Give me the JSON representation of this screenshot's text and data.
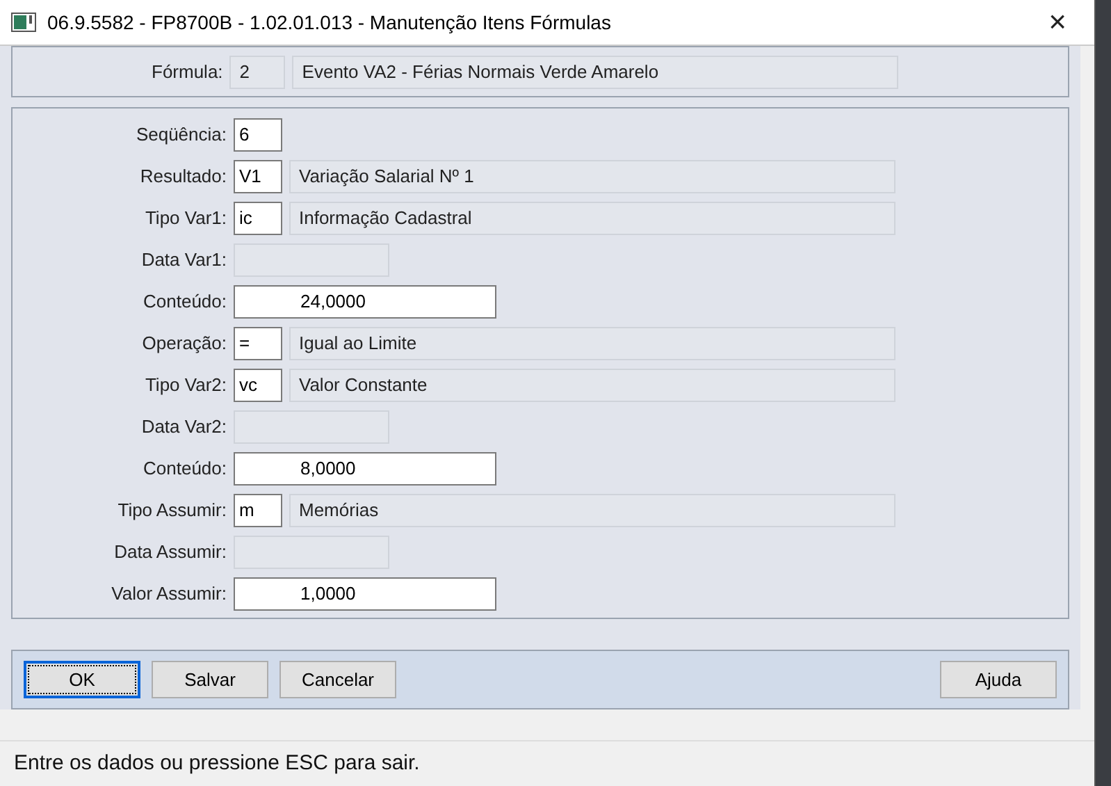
{
  "window": {
    "title": "06.9.5582 - FP8700B - 1.02.01.013 - Manutenção Itens Fórmulas",
    "close": "×"
  },
  "header": {
    "label": "Fórmula:",
    "code": "2",
    "description": "Evento VA2 - Férias Normais Verde Amarelo"
  },
  "fields": [
    {
      "kind": "code",
      "label": "Seqüência:",
      "value": "6"
    },
    {
      "kind": "coded",
      "label": "Resultado:",
      "value": "V1",
      "description": "Variação Salarial Nº 1"
    },
    {
      "kind": "coded",
      "label": "Tipo Var1:",
      "value": "ic",
      "description": "Informação Cadastral"
    },
    {
      "kind": "date",
      "label": "Data Var1:"
    },
    {
      "kind": "number",
      "label": "Conteúdo:",
      "value": "24,0000"
    },
    {
      "kind": "coded",
      "label": "Operação:",
      "value": "=",
      "description": "Igual ao Limite"
    },
    {
      "kind": "coded",
      "label": "Tipo Var2:",
      "value": "vc",
      "description": "Valor Constante"
    },
    {
      "kind": "date",
      "label": "Data Var2:"
    },
    {
      "kind": "number",
      "label": "Conteúdo:",
      "value": "8,0000"
    },
    {
      "kind": "coded",
      "label": "Tipo Assumir:",
      "value": "m",
      "description": "Memórias"
    },
    {
      "kind": "date",
      "label": "Data Assumir:"
    },
    {
      "kind": "number",
      "label": "Valor Assumir:",
      "value": "1,0000"
    }
  ],
  "buttons": [
    {
      "kind": "action",
      "label": "OK",
      "focused": true
    },
    {
      "kind": "action",
      "label": "Salvar",
      "focused": false
    },
    {
      "kind": "action",
      "label": "Cancelar",
      "focused": false
    },
    {
      "kind": "help",
      "label": "Ajuda",
      "focused": false
    }
  ],
  "status_bar": "Entre os dados ou pressione ESC para sair."
}
